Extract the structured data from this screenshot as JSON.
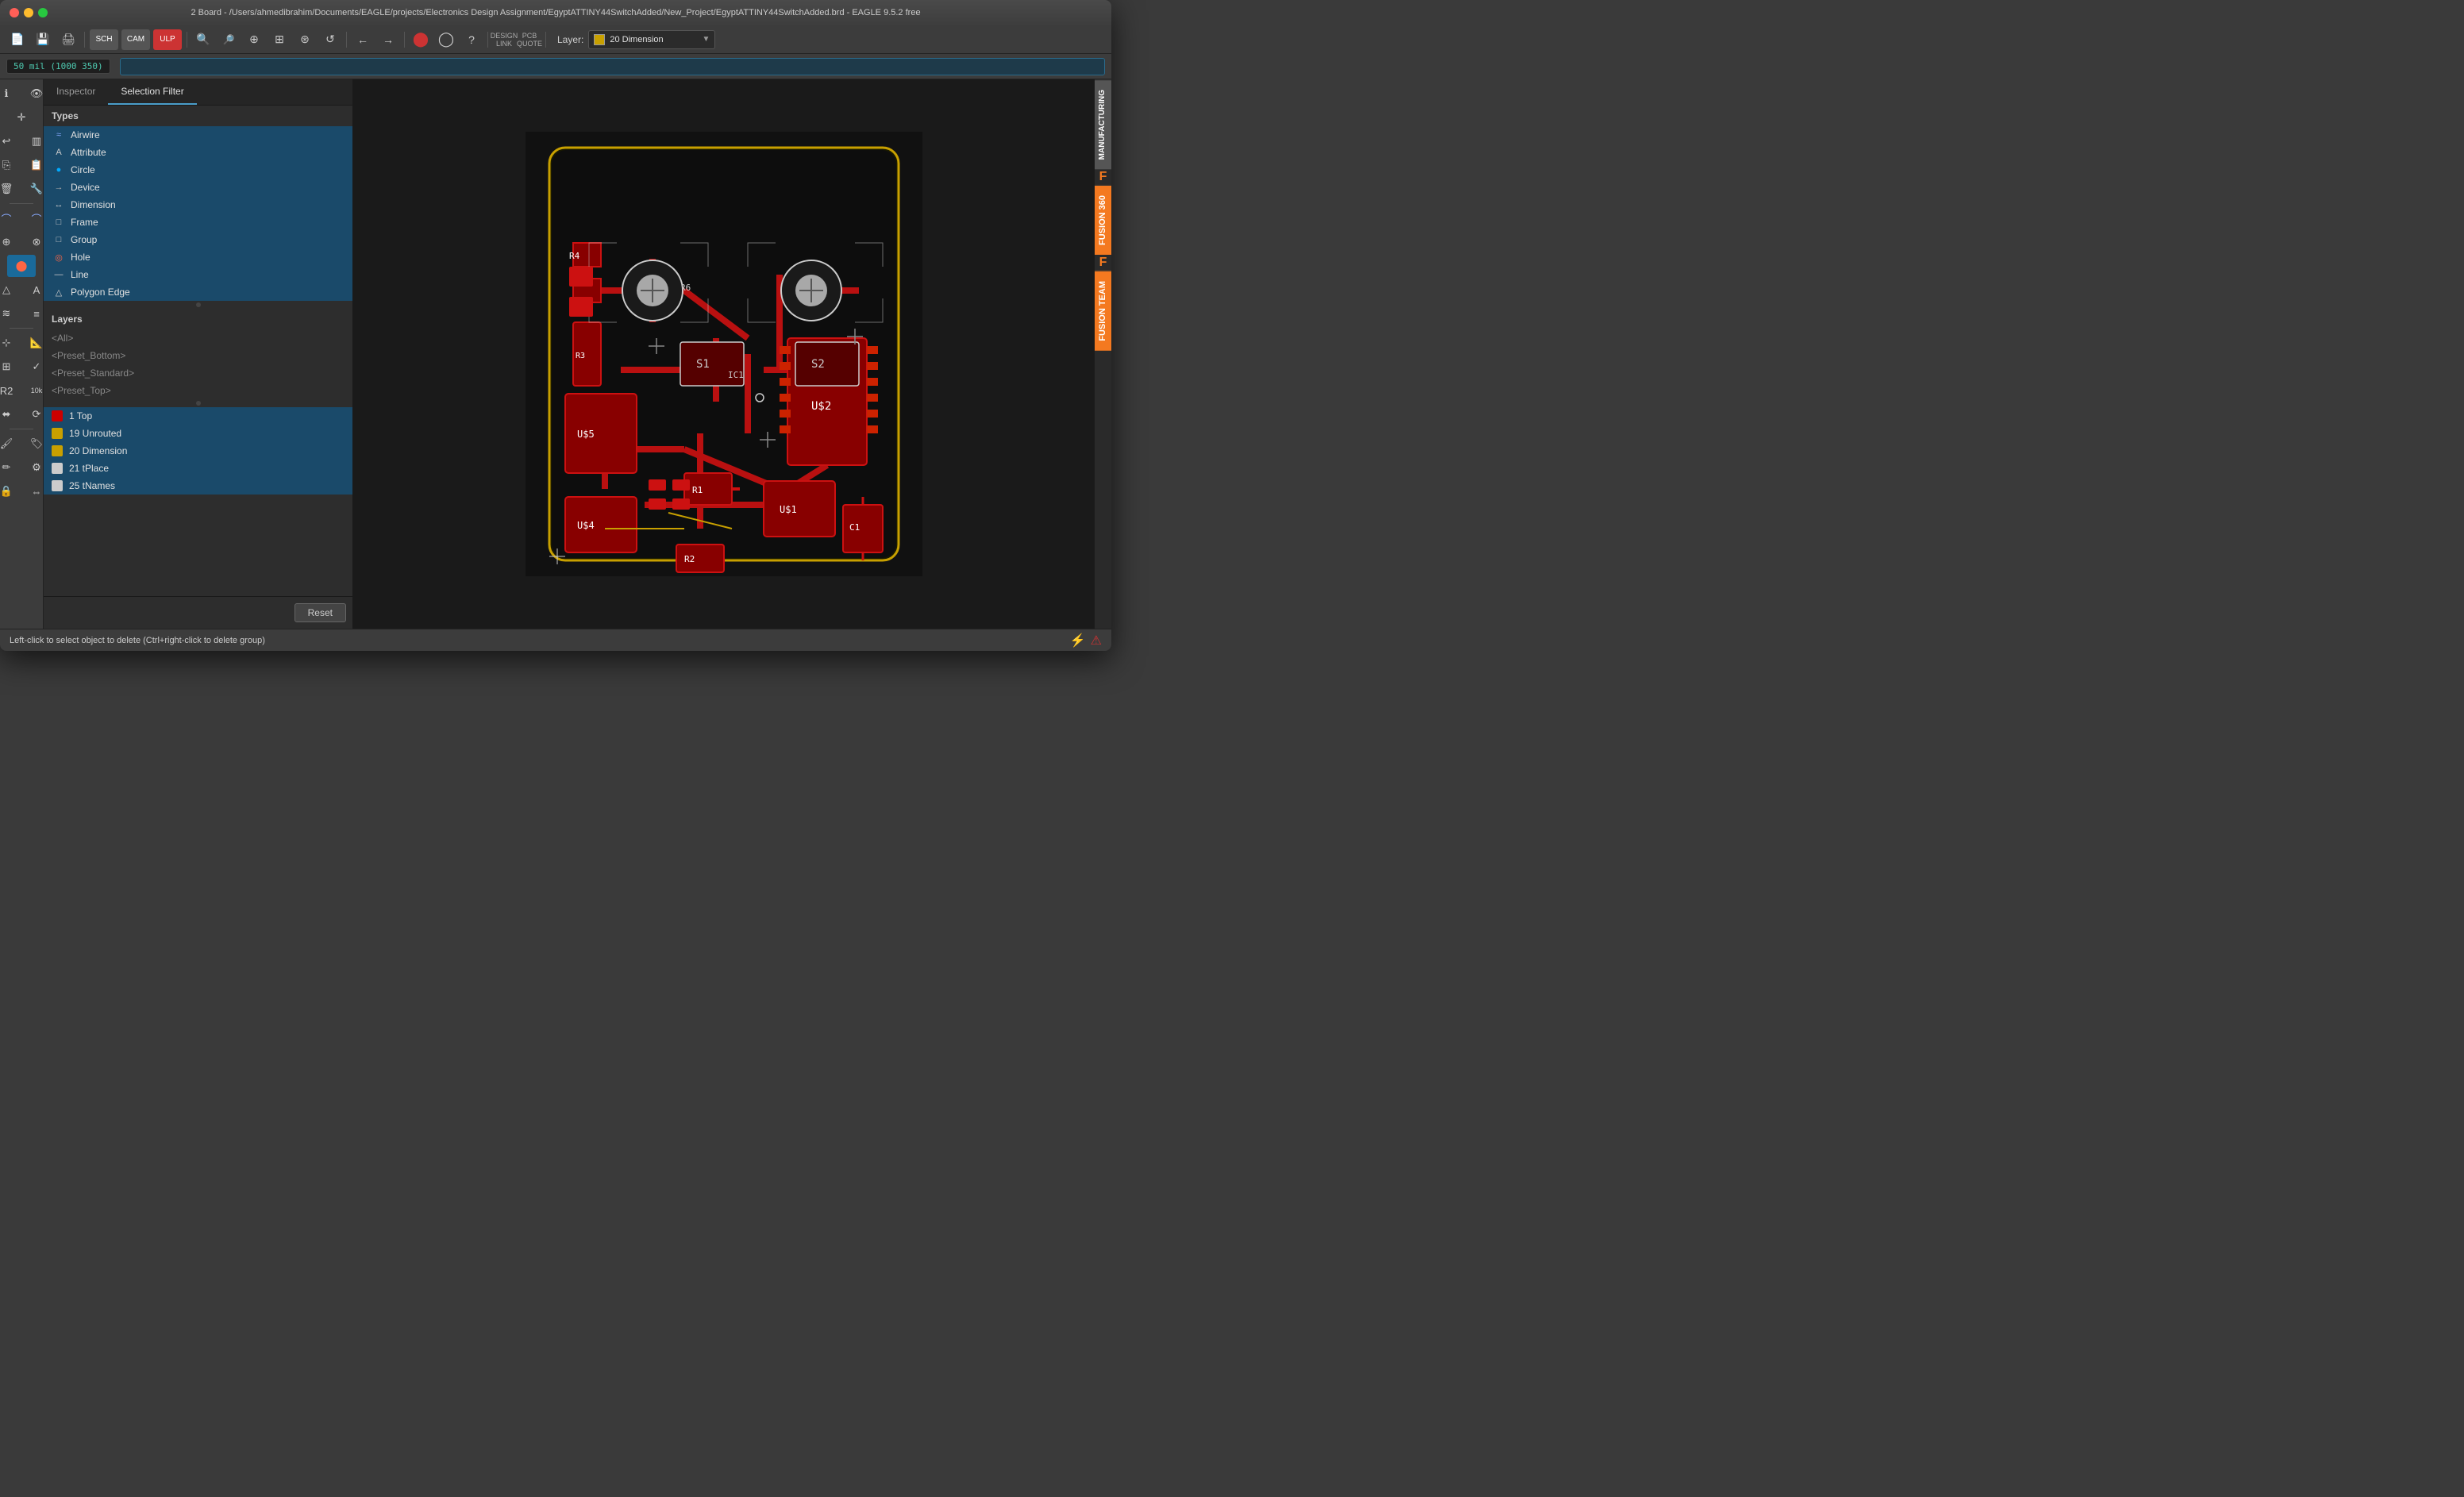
{
  "window": {
    "title": "2 Board - /Users/ahmedibrahim/Documents/EAGLE/projects/Electronics Design Assignment/EgyptATTINY44SwitchAdded/New_Project/EgyptATTINY44SwitchAdded.brd - EAGLE 9.5.2 free"
  },
  "toolbar": {
    "layer_label": "Layer:",
    "layer_name": "20 Dimension",
    "coord": "50 mil (1000 350)"
  },
  "panel": {
    "tab_inspector": "Inspector",
    "tab_selection_filter": "Selection Filter",
    "types_header": "Types",
    "layers_header": "Layers",
    "reset_button": "Reset"
  },
  "types": [
    {
      "name": "Airwire",
      "icon": "~"
    },
    {
      "name": "Attribute",
      "icon": "A"
    },
    {
      "name": "Circle",
      "icon": "○"
    },
    {
      "name": "Device",
      "icon": "→"
    },
    {
      "name": "Dimension",
      "icon": "⟷"
    },
    {
      "name": "Frame",
      "icon": "□"
    },
    {
      "name": "Group",
      "icon": "□"
    },
    {
      "name": "Hole",
      "icon": "●"
    },
    {
      "name": "Line",
      "icon": "—"
    },
    {
      "name": "Polygon Edge",
      "icon": "△"
    }
  ],
  "layer_presets": [
    "<All>",
    "<Preset_Bottom>",
    "<Preset_Standard>",
    "<Preset_Top>"
  ],
  "layers": [
    {
      "name": "1 Top",
      "color": "#cc0000",
      "selected": true
    },
    {
      "name": "19 Unrouted",
      "color": "#c8a000",
      "selected": true
    },
    {
      "name": "20 Dimension",
      "color": "#c8a000",
      "selected": true
    },
    {
      "name": "21 tPlace",
      "color": "#cccccc",
      "selected": true
    },
    {
      "name": "25 tNames",
      "color": "#cccccc",
      "selected": true
    }
  ],
  "right_panels": [
    {
      "label": "MANUFACTURING",
      "style": "mfg"
    },
    {
      "label": "FUSION 360",
      "style": "fusion"
    },
    {
      "label": "FUSION TEAM",
      "style": "fusion-team"
    }
  ],
  "status": {
    "text": "Left-click to select object to delete (Ctrl+right-click to delete group)"
  }
}
